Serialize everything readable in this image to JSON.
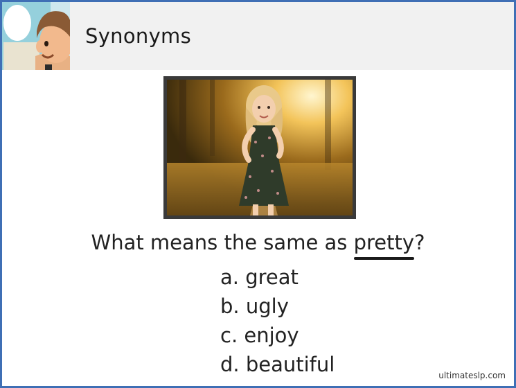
{
  "header": {
    "title": "Synonyms",
    "accent_color": "#3f6fb5"
  },
  "image": {
    "icon": "girl-in-forest-photo"
  },
  "question": {
    "prefix": "What means the same as ",
    "target_word": "pretty",
    "suffix": "?"
  },
  "options": [
    {
      "label": "a. great"
    },
    {
      "label": "b. ugly"
    },
    {
      "label": "c. enjoy"
    },
    {
      "label": "d. beautiful"
    }
  ],
  "footer": {
    "credit": "ultimateslp.com"
  }
}
